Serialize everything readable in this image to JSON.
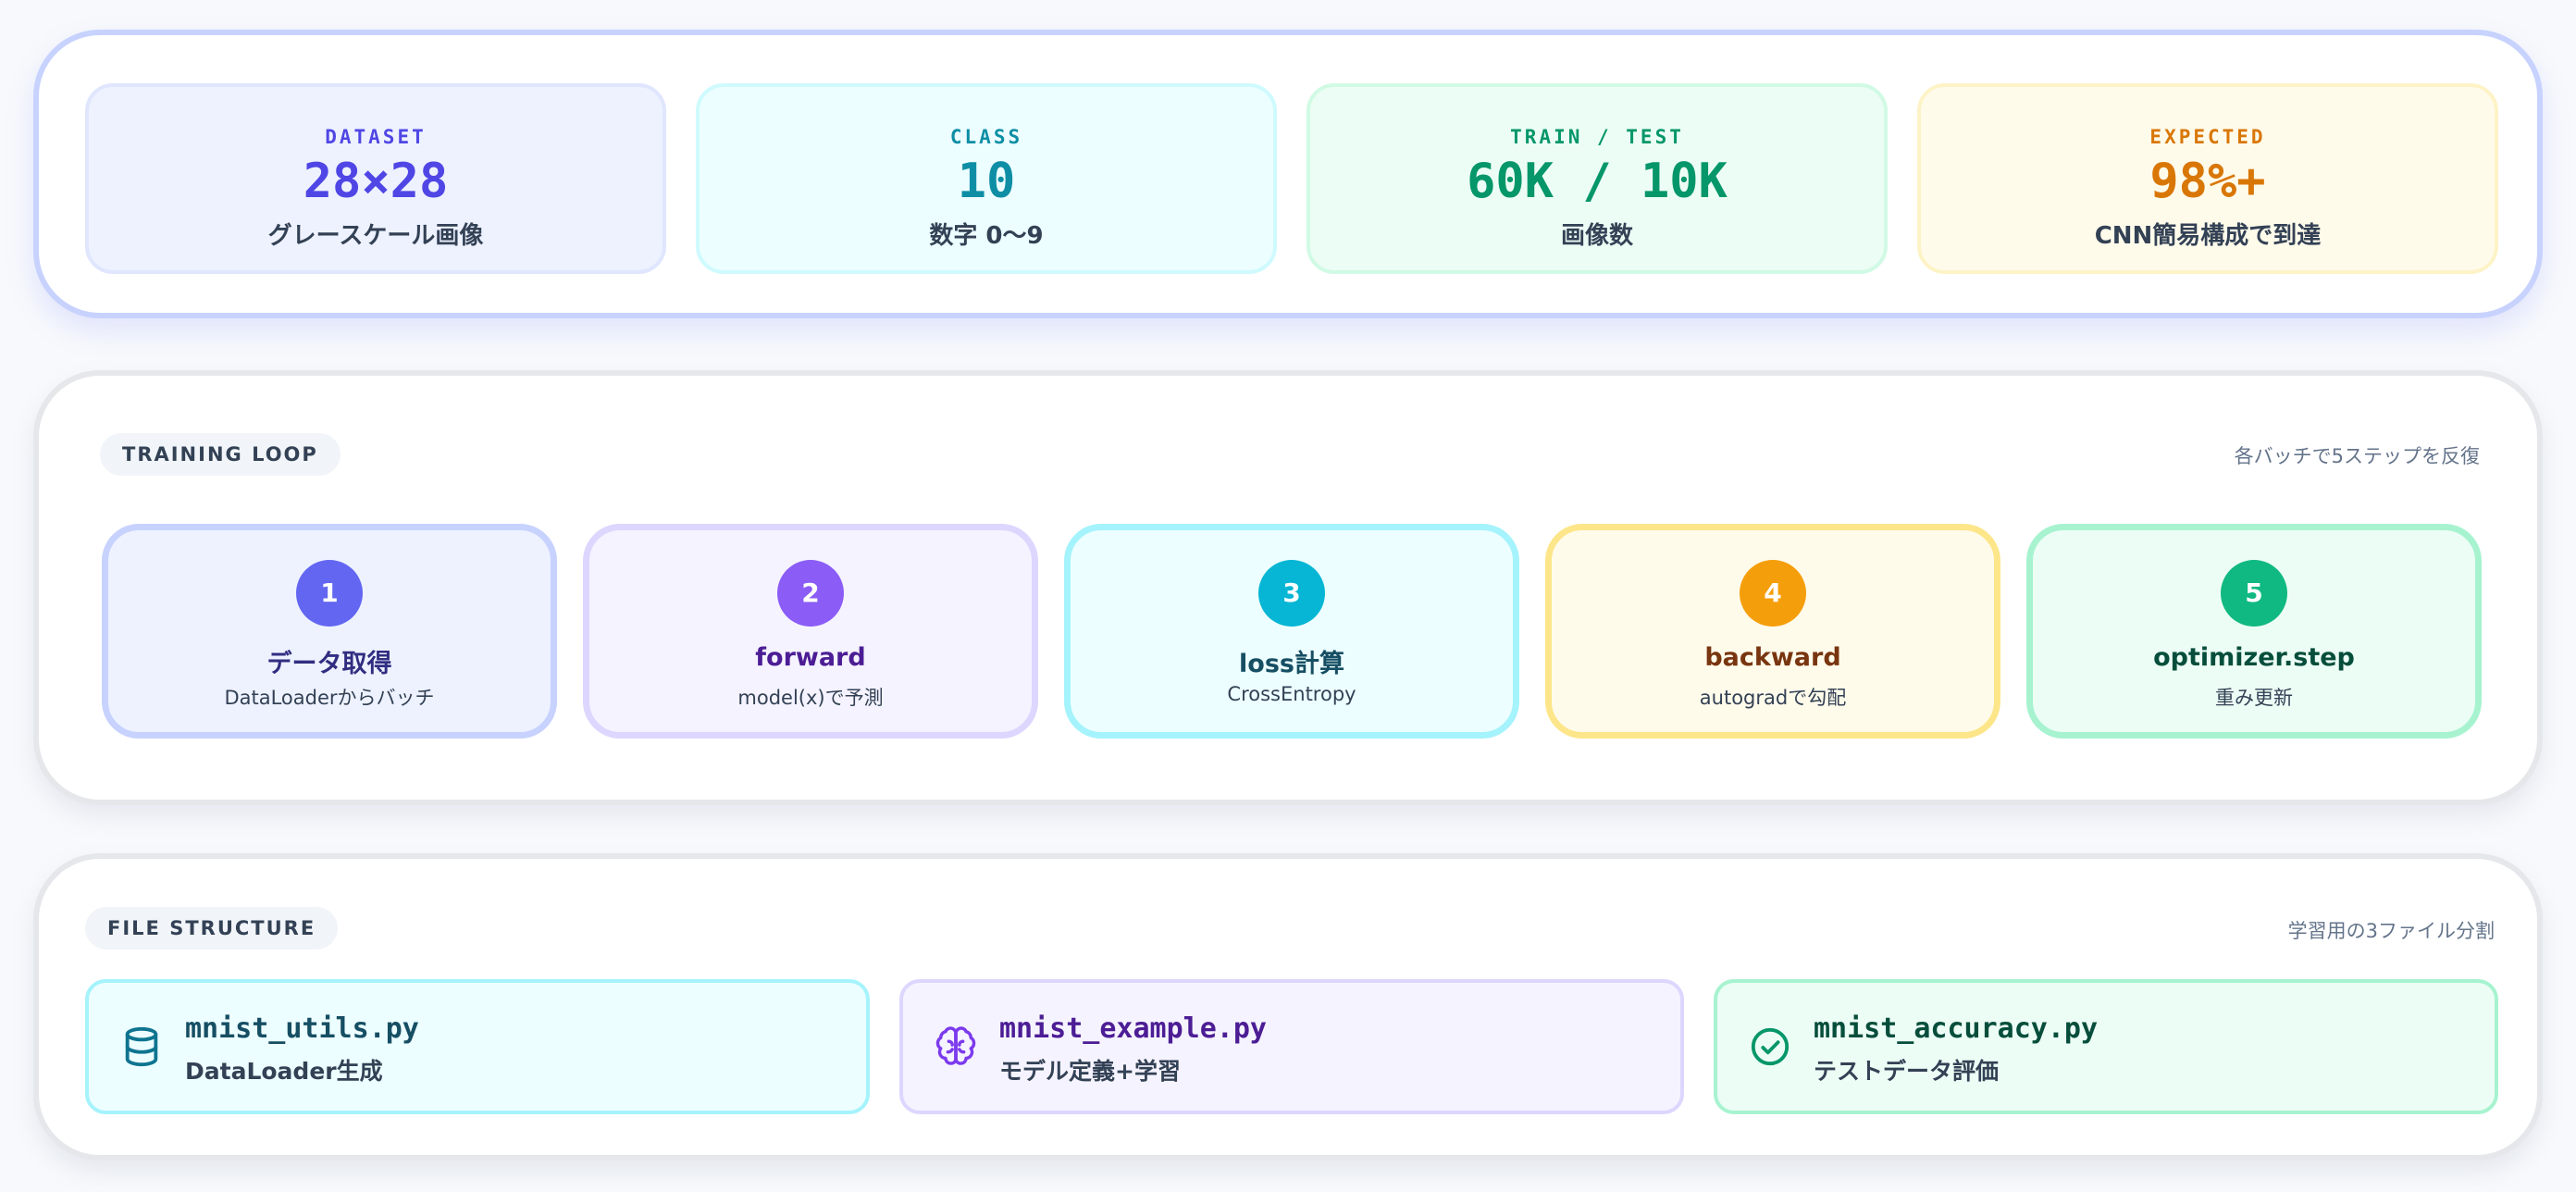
{
  "stats": [
    {
      "label": "DATASET",
      "value": "28×28",
      "sub": "グレースケール画像",
      "color": "#4f46e5",
      "bg": "#eef2ff",
      "border": "#dfe6fd"
    },
    {
      "label": "CLASS",
      "value": "10",
      "sub": "数字 0〜9",
      "color": "#0e8ea5",
      "bg": "#ecfeff",
      "border": "#cffafe"
    },
    {
      "label": "TRAIN / TEST",
      "value": "60K / 10K",
      "sub": "画像数",
      "color": "#059669",
      "bg": "#ecfdf5",
      "border": "#d1fae5"
    },
    {
      "label": "EXPECTED",
      "value": "98%+",
      "sub": "CNN簡易構成で到達",
      "color": "#d97706",
      "bg": "#fffbeb",
      "border": "#fef3c7"
    }
  ],
  "training_loop": {
    "title": "TRAINING LOOP",
    "note": "各バッチで5ステップを反復",
    "steps": [
      {
        "number": "1",
        "title": "データ取得",
        "sub": "DataLoaderからバッチ",
        "circle": "#6366f1",
        "bg": "#eef2ff",
        "border": "#c7d2fe",
        "title_color": "#312e81"
      },
      {
        "number": "2",
        "title": "forward",
        "sub": "model(x)で予測",
        "circle": "#8b5cf6",
        "bg": "#f5f3ff",
        "border": "#ddd6fe",
        "title_color": "#4c1d95"
      },
      {
        "number": "3",
        "title": "loss計算",
        "sub": "CrossEntropy",
        "circle": "#06b6d4",
        "bg": "#ecfeff",
        "border": "#a5f3fc",
        "title_color": "#164e63"
      },
      {
        "number": "4",
        "title": "backward",
        "sub": "autogradで勾配",
        "circle": "#f59e0b",
        "bg": "#fffbeb",
        "border": "#fde68a",
        "title_color": "#78350f"
      },
      {
        "number": "5",
        "title": "optimizer.step",
        "sub": "重み更新",
        "circle": "#10b981",
        "bg": "#ecfdf5",
        "border": "#a7f3d0",
        "title_color": "#064e3b"
      }
    ]
  },
  "file_structure": {
    "title": "FILE STRUCTURE",
    "note": "学習用の3ファイル分割",
    "files": [
      {
        "name": "mnist_utils.py",
        "desc": "DataLoader生成",
        "icon": "database-icon",
        "color": "#0e7490",
        "name_color": "#164e63",
        "bg": "#ecfeff",
        "border": "#a5f3fc"
      },
      {
        "name": "mnist_example.py",
        "desc": "モデル定義+学習",
        "icon": "brain-icon",
        "color": "#7c3aed",
        "name_color": "#4c1d95",
        "bg": "#f5f3ff",
        "border": "#ddd6fe"
      },
      {
        "name": "mnist_accuracy.py",
        "desc": "テストデータ評価",
        "icon": "check-circle-icon",
        "color": "#059669",
        "name_color": "#064e3b",
        "bg": "#ecfdf5",
        "border": "#a7f3d0"
      }
    ]
  }
}
